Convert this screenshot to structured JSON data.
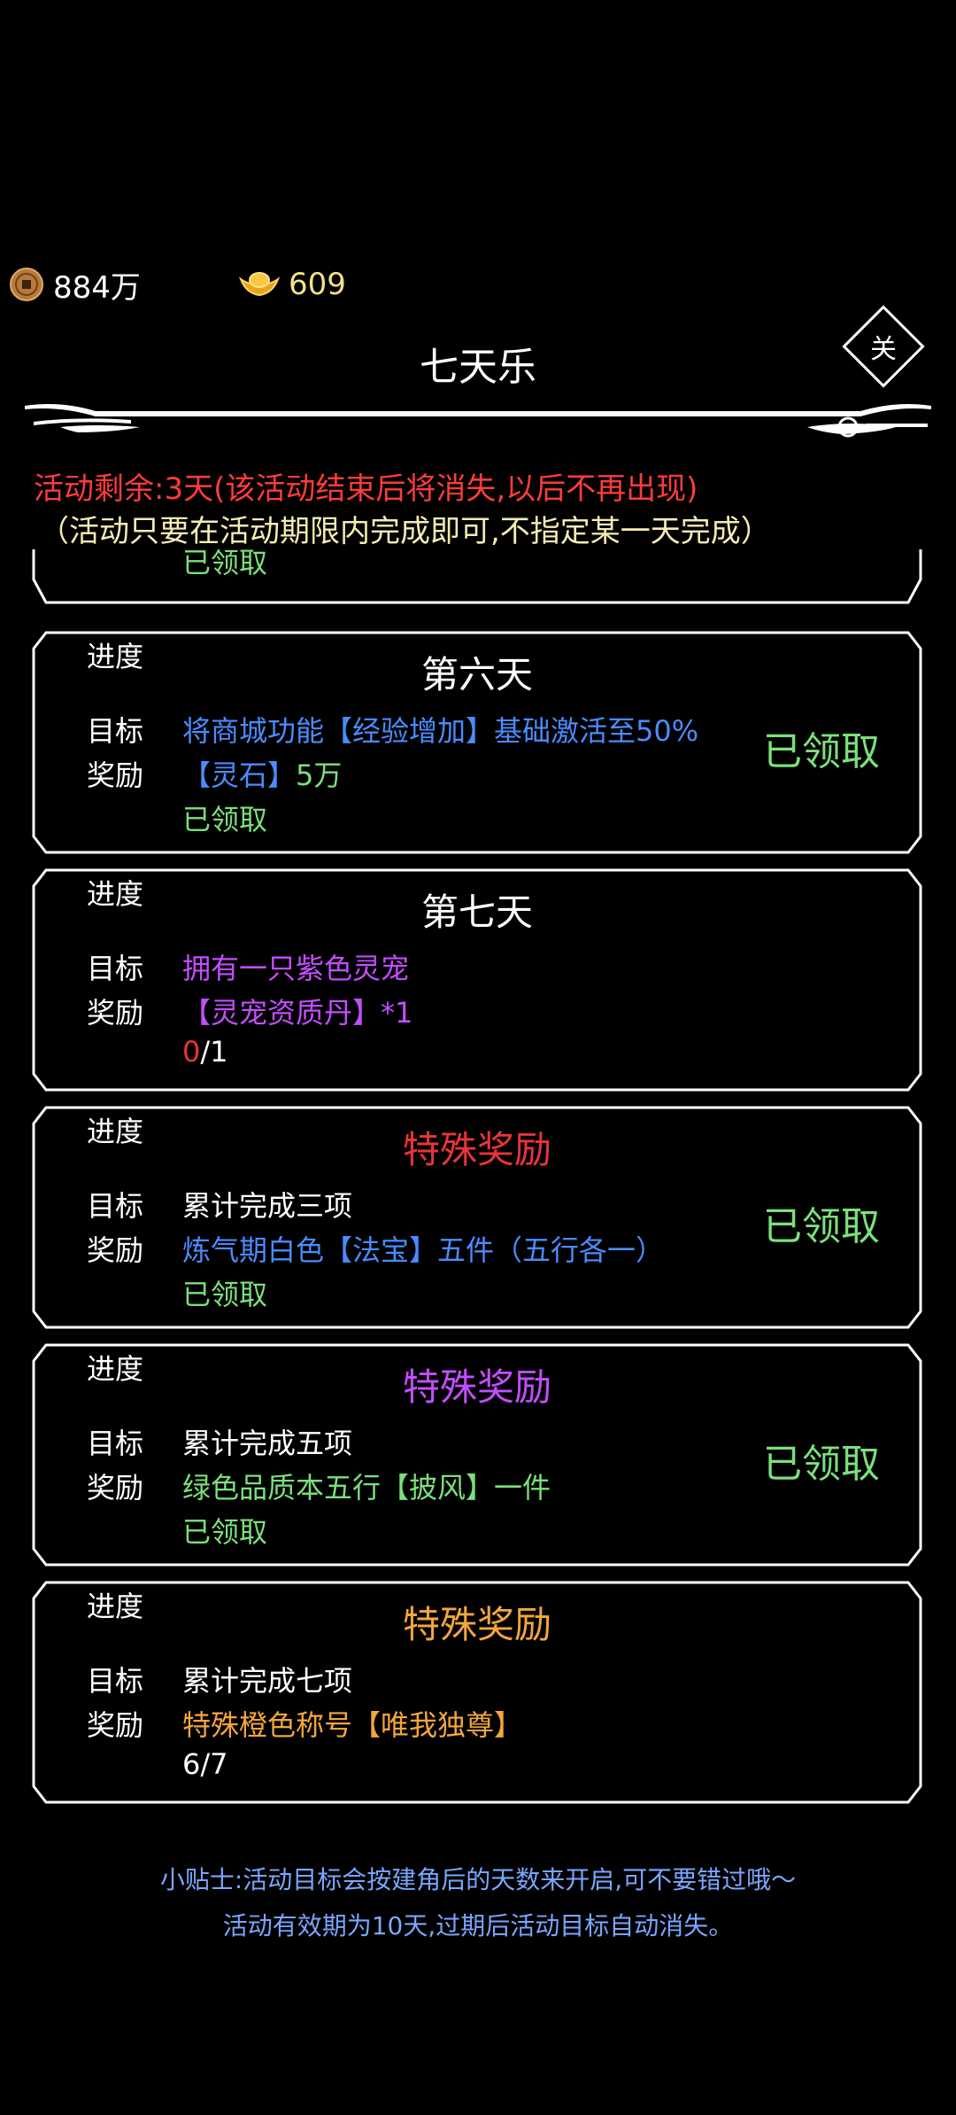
{
  "currency": {
    "coins": "884万",
    "ingots": "609",
    "coin_icon": "copper-coin-icon",
    "ingot_icon": "gold-ingot-icon"
  },
  "header": {
    "title": "七天乐",
    "close_label": "关"
  },
  "notice": {
    "remaining": "活动剩余:3天(该活动结束后将消失,以后不再出现)",
    "hint": "（活动只要在活动期限内完成即可,不指定某一天完成）"
  },
  "labels": {
    "progress": "进度",
    "goal": "目标",
    "reward": "奖励"
  },
  "partial_card": {
    "progress": "已领取"
  },
  "cards": [
    {
      "title": "第六天",
      "title_color": "#ffffff",
      "goal": "将商城功能【经验增加】基础激活至50%",
      "goal_color": "#4a8cff",
      "reward_prefix": "【灵石】",
      "reward_suffix": "5万",
      "reward_color": "#4a8cff",
      "progress": "已领取",
      "progress_color": "#7be07b",
      "status": "已领取"
    },
    {
      "title": "第七天",
      "title_color": "#ffffff",
      "goal": "拥有一只紫色灵宠",
      "goal_color": "#c44dff",
      "reward": "【灵宠资质丹】*1",
      "reward_color": "#c44dff",
      "progress_current": "0",
      "progress_total": "/1"
    },
    {
      "title": "特殊奖励",
      "title_color": "#e8343a",
      "goal": "累计完成三项",
      "goal_color": "#ffffff",
      "reward": "炼气期白色【法宝】五件（五行各一）",
      "reward_color": "#4a8cff",
      "progress": "已领取",
      "progress_color": "#7be07b",
      "status": "已领取"
    },
    {
      "title": "特殊奖励",
      "title_color": "#c44dff",
      "goal": "累计完成五项",
      "goal_color": "#ffffff",
      "reward": "绿色品质本五行【披风】一件",
      "reward_color": "#7be07b",
      "progress": "已领取",
      "progress_color": "#7be07b",
      "status": "已领取"
    },
    {
      "title": "特殊奖励",
      "title_color": "#f4a63a",
      "goal": "累计完成七项",
      "goal_color": "#ffffff",
      "reward": "特殊橙色称号【唯我独尊】",
      "reward_color": "#f4a63a",
      "progress": "6/7",
      "progress_color": "#ffffff"
    }
  ],
  "tips": {
    "line1": "小贴士:活动目标会按建角后的天数来开启,可不要错过哦～",
    "line2": "活动有效期为10天,过期后活动目标自动消失。"
  }
}
